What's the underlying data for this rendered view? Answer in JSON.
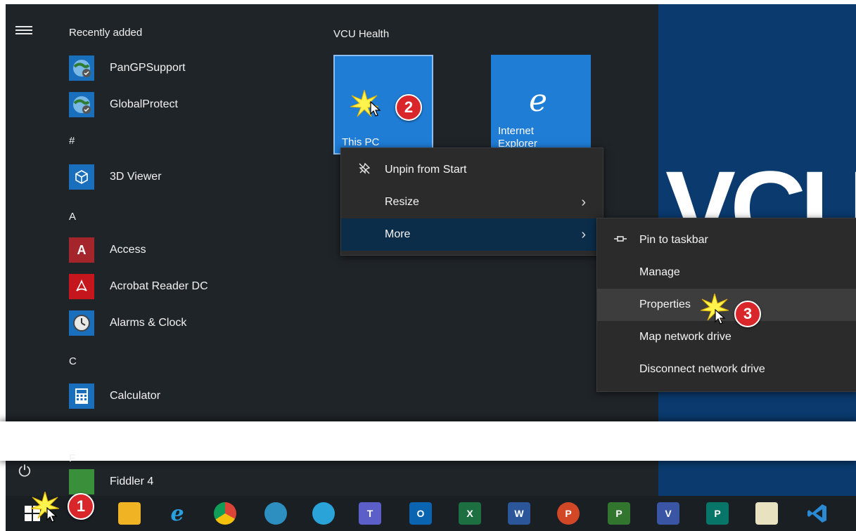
{
  "start_menu": {
    "recently_added": {
      "heading": "Recently added",
      "items": [
        {
          "label": "PanGPSupport"
        },
        {
          "label": "GlobalProtect"
        }
      ]
    },
    "sections": [
      {
        "letter": "#",
        "items": [
          {
            "label": "3D Viewer"
          }
        ]
      },
      {
        "letter": "A",
        "items": [
          {
            "label": "Access"
          },
          {
            "label": "Acrobat Reader DC"
          },
          {
            "label": "Alarms & Clock"
          }
        ]
      },
      {
        "letter": "C",
        "items": [
          {
            "label": "Calculator"
          }
        ]
      },
      {
        "letter": "F",
        "items": [
          {
            "label": "Fiddler 4"
          }
        ]
      }
    ],
    "tile_group": {
      "title": "VCU Health",
      "tiles": [
        {
          "label": "This PC"
        },
        {
          "label": "Internet Explorer"
        }
      ]
    }
  },
  "context_menu": {
    "items": [
      {
        "label": "Unpin from Start"
      },
      {
        "label": "Resize"
      },
      {
        "label": "More"
      }
    ]
  },
  "submenu": {
    "items": [
      {
        "label": "Pin to taskbar"
      },
      {
        "label": "Manage"
      },
      {
        "label": "Properties"
      },
      {
        "label": "Map network drive"
      },
      {
        "label": "Disconnect network drive"
      }
    ]
  },
  "wallpaper": {
    "logo_text": "VCU"
  },
  "callouts": [
    "1",
    "2",
    "3"
  ],
  "taskbar": {
    "apps": [
      {
        "icon": "file-explorer-icon",
        "text": ""
      },
      {
        "icon": "internet-explorer-icon",
        "text": "e"
      },
      {
        "icon": "chrome-icon",
        "text": ""
      },
      {
        "icon": "edge-dev-icon",
        "text": ""
      },
      {
        "icon": "edge-icon",
        "text": ""
      },
      {
        "icon": "teams-icon",
        "text": "T"
      },
      {
        "icon": "outlook-icon",
        "text": "O"
      },
      {
        "icon": "excel-icon",
        "text": "X"
      },
      {
        "icon": "word-icon",
        "text": "W"
      },
      {
        "icon": "powerpoint-icon",
        "text": "P"
      },
      {
        "icon": "project-icon",
        "text": "P"
      },
      {
        "icon": "visio-icon",
        "text": "V"
      },
      {
        "icon": "publisher-icon",
        "text": "P"
      },
      {
        "icon": "notepad-plus-icon",
        "text": ""
      },
      {
        "icon": "vscode-icon",
        "text": ""
      }
    ]
  },
  "colors": {
    "start_bg": "#1f2428",
    "tile_blue": "#1f7dd6",
    "menu_bg": "#2b2b2b",
    "menu_highlight": "#0b2d4a",
    "callout_red": "#d8262a",
    "wallpaper_blue": "#0a3a6e"
  }
}
